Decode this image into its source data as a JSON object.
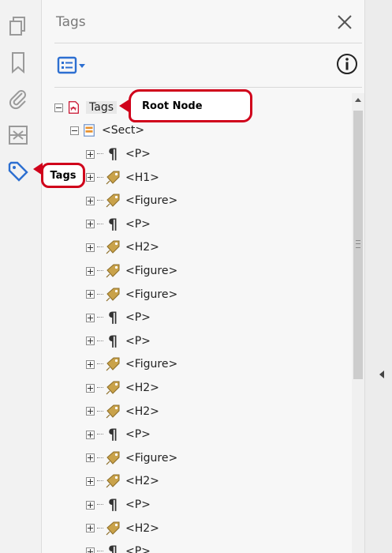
{
  "panel": {
    "title": "Tags"
  },
  "rail_icons": [
    "pages-icon",
    "bookmark-icon",
    "attachment-icon",
    "compare-icon",
    "tags-icon"
  ],
  "tree": {
    "root": "Tags",
    "sect": "<Sect>",
    "items": [
      {
        "label": "<P>",
        "icon": "paragraph"
      },
      {
        "label": "<H1>",
        "icon": "tag"
      },
      {
        "label": "<Figure>",
        "icon": "tag"
      },
      {
        "label": "<P>",
        "icon": "paragraph"
      },
      {
        "label": "<H2>",
        "icon": "tag"
      },
      {
        "label": "<Figure>",
        "icon": "tag"
      },
      {
        "label": "<Figure>",
        "icon": "tag"
      },
      {
        "label": "<P>",
        "icon": "paragraph"
      },
      {
        "label": "<P>",
        "icon": "paragraph"
      },
      {
        "label": "<Figure>",
        "icon": "tag"
      },
      {
        "label": "<H2>",
        "icon": "tag"
      },
      {
        "label": "<H2>",
        "icon": "tag"
      },
      {
        "label": "<P>",
        "icon": "paragraph"
      },
      {
        "label": "<Figure>",
        "icon": "tag"
      },
      {
        "label": "<H2>",
        "icon": "tag"
      },
      {
        "label": "<P>",
        "icon": "paragraph"
      },
      {
        "label": "<H2>",
        "icon": "tag"
      },
      {
        "label": "<P>",
        "icon": "paragraph"
      }
    ]
  },
  "annotations": {
    "root_node": "Root Node",
    "tags": "Tags"
  },
  "colors": {
    "accent_blue": "#2d6fd1",
    "annotation_red": "#d0021b",
    "tag_gold": "#c9a24a"
  }
}
